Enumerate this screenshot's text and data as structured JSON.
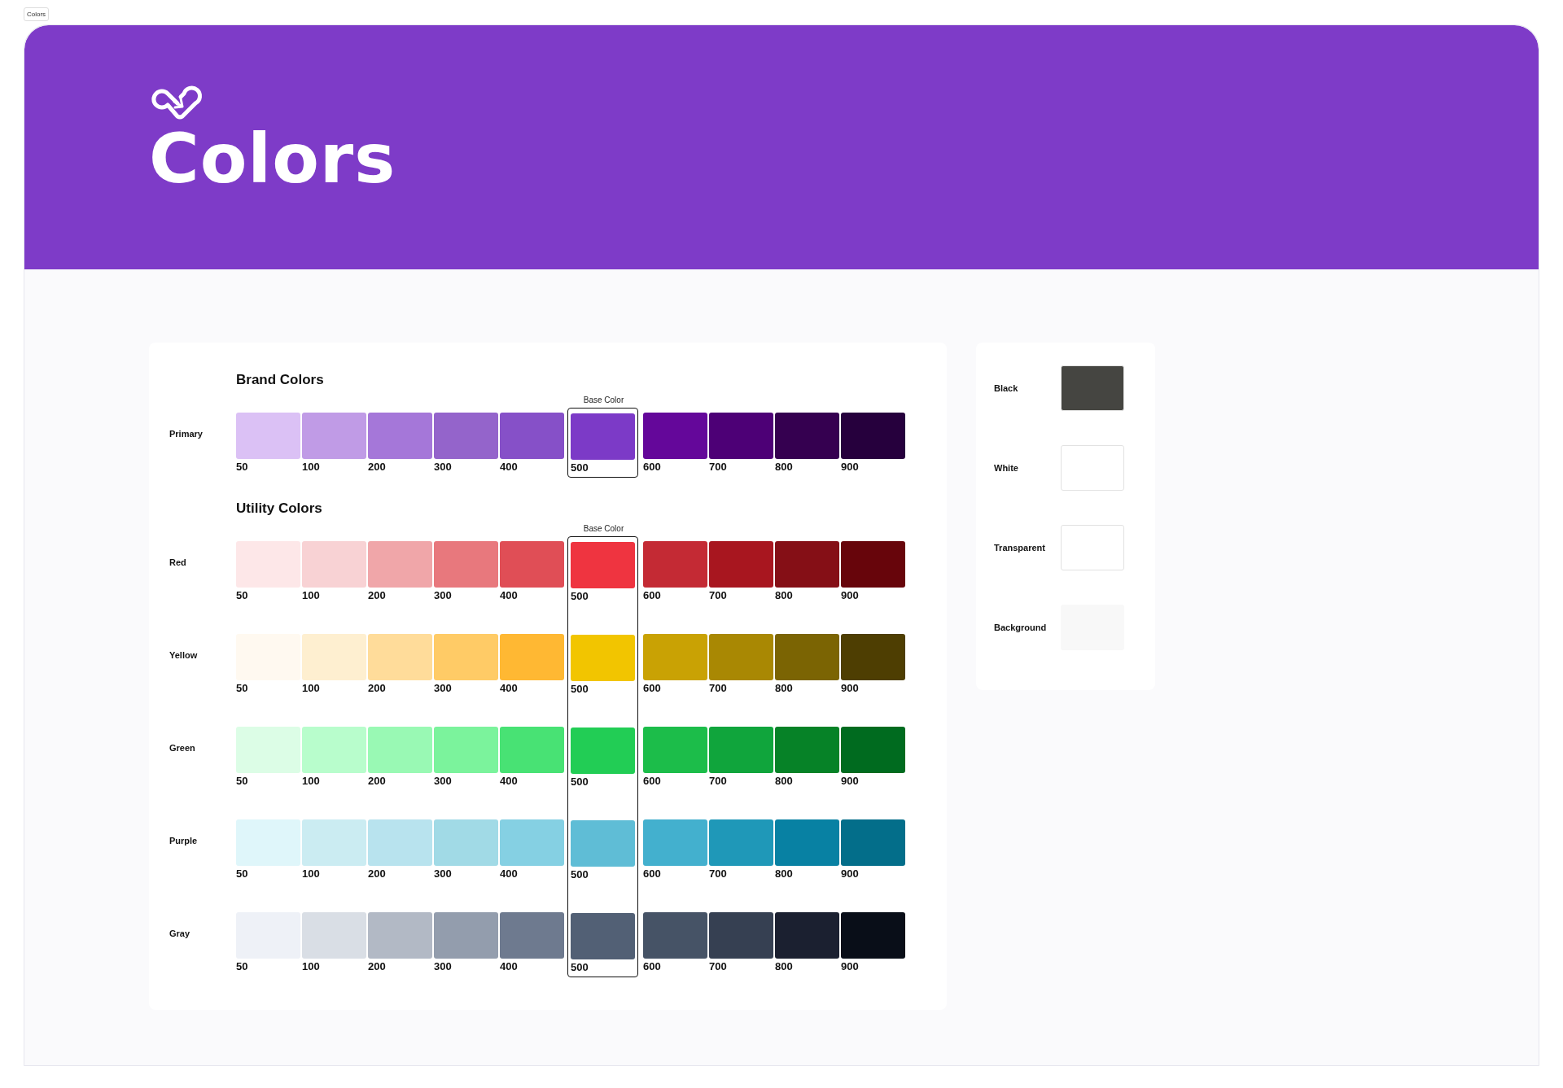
{
  "frame_label": "Colors",
  "header": {
    "title": "Colors"
  },
  "sections": [
    {
      "title": "Brand Colors",
      "base_label": "Base Color",
      "columns": [
        {
          "base": false
        },
        {
          "base": false
        },
        {
          "base": false
        },
        {
          "base": false
        },
        {
          "base": false
        },
        {
          "base": true
        },
        {
          "base": false
        },
        {
          "base": false
        },
        {
          "base": false
        },
        {
          "base": false
        }
      ],
      "rows": [
        {
          "name": "Primary",
          "swatches": [
            {
              "label": "50",
              "color": "#dbc1f5"
            },
            {
              "label": "100",
              "color": "#c09be6"
            },
            {
              "label": "200",
              "color": "#a577d9"
            },
            {
              "label": "300",
              "color": "#9464cb"
            },
            {
              "label": "400",
              "color": "#8650c8"
            },
            {
              "label": "500",
              "color": "#7c3ac7"
            },
            {
              "label": "600",
              "color": "#64079a"
            },
            {
              "label": "700",
              "color": "#4d0076"
            },
            {
              "label": "800",
              "color": "#350050"
            },
            {
              "label": "900",
              "color": "#26003d"
            }
          ]
        }
      ]
    },
    {
      "title": "Utility Colors",
      "base_label": "Base Color",
      "columns": [
        {
          "base": false
        },
        {
          "base": false
        },
        {
          "base": false
        },
        {
          "base": false
        },
        {
          "base": false
        },
        {
          "base": true
        },
        {
          "base": false
        },
        {
          "base": false
        },
        {
          "base": false
        },
        {
          "base": false
        }
      ],
      "rows": [
        {
          "name": "Red",
          "swatches": [
            {
              "label": "50",
              "color": "#fde7e8"
            },
            {
              "label": "100",
              "color": "#f8d2d4"
            },
            {
              "label": "200",
              "color": "#f0a6a9"
            },
            {
              "label": "300",
              "color": "#e8787d"
            },
            {
              "label": "400",
              "color": "#e04e56"
            },
            {
              "label": "500",
              "color": "#ef3440"
            },
            {
              "label": "600",
              "color": "#c42a34"
            },
            {
              "label": "700",
              "color": "#a8161f"
            },
            {
              "label": "800",
              "color": "#850f16"
            },
            {
              "label": "900",
              "color": "#67050b"
            }
          ]
        },
        {
          "name": "Yellow",
          "swatches": [
            {
              "label": "50",
              "color": "#fff9f0"
            },
            {
              "label": "100",
              "color": "#feefd0"
            },
            {
              "label": "200",
              "color": "#ffdc9a"
            },
            {
              "label": "300",
              "color": "#ffcb66"
            },
            {
              "label": "400",
              "color": "#ffb833"
            },
            {
              "label": "500",
              "color": "#f2c500"
            },
            {
              "label": "600",
              "color": "#c9a204"
            },
            {
              "label": "700",
              "color": "#a98803"
            },
            {
              "label": "800",
              "color": "#7b6403"
            },
            {
              "label": "900",
              "color": "#4e3e02"
            }
          ]
        },
        {
          "name": "Green",
          "swatches": [
            {
              "label": "50",
              "color": "#dcfde6"
            },
            {
              "label": "100",
              "color": "#b8fdcc"
            },
            {
              "label": "200",
              "color": "#99f9b4"
            },
            {
              "label": "300",
              "color": "#7bf39c"
            },
            {
              "label": "400",
              "color": "#48e274"
            },
            {
              "label": "500",
              "color": "#22cd55"
            },
            {
              "label": "600",
              "color": "#1cbd4a"
            },
            {
              "label": "700",
              "color": "#10a53c"
            },
            {
              "label": "800",
              "color": "#068227"
            },
            {
              "label": "900",
              "color": "#006b1f"
            }
          ]
        },
        {
          "name": "Purple",
          "swatches": [
            {
              "label": "50",
              "color": "#dff6fa"
            },
            {
              "label": "100",
              "color": "#cbecf2"
            },
            {
              "label": "200",
              "color": "#b8e3ee"
            },
            {
              "label": "300",
              "color": "#a1dae6"
            },
            {
              "label": "400",
              "color": "#85d0e3"
            },
            {
              "label": "500",
              "color": "#5fbdd6"
            },
            {
              "label": "600",
              "color": "#43b0ce"
            },
            {
              "label": "700",
              "color": "#1f98b8"
            },
            {
              "label": "800",
              "color": "#0881a3"
            },
            {
              "label": "900",
              "color": "#036e8a"
            }
          ]
        },
        {
          "name": "Gray",
          "swatches": [
            {
              "label": "50",
              "color": "#eef1f7"
            },
            {
              "label": "100",
              "color": "#d9dee5"
            },
            {
              "label": "200",
              "color": "#b2b9c5"
            },
            {
              "label": "300",
              "color": "#939dad"
            },
            {
              "label": "400",
              "color": "#6e7a8f"
            },
            {
              "label": "500",
              "color": "#526075"
            },
            {
              "label": "600",
              "color": "#465366"
            },
            {
              "label": "700",
              "color": "#364052"
            },
            {
              "label": "800",
              "color": "#1b2030"
            },
            {
              "label": "900",
              "color": "#090e18"
            }
          ]
        }
      ]
    }
  ],
  "neutrals": [
    {
      "name": "Black",
      "color": "#454541"
    },
    {
      "name": "White",
      "color": "#ffffff"
    },
    {
      "name": "Transparent",
      "color": "#ffffff"
    },
    {
      "name": "Background",
      "color": "#f8f8f8"
    }
  ]
}
